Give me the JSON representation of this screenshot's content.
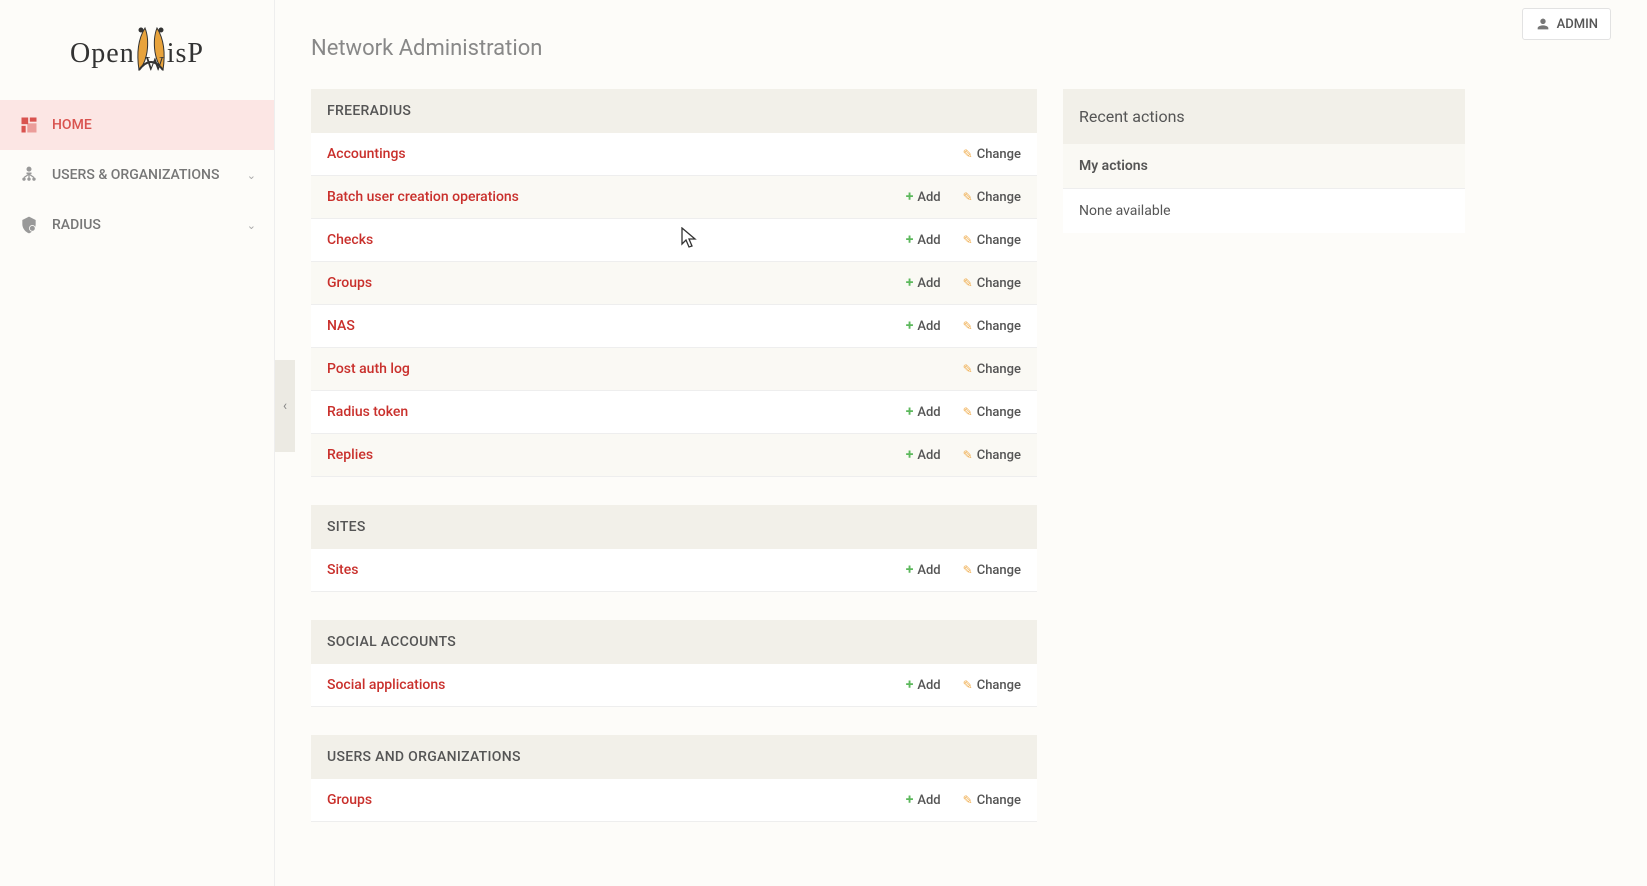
{
  "header": {
    "logo_text": "OpenWisp",
    "user_label": "ADMIN",
    "page_title": "Network Administration"
  },
  "sidebar": {
    "items": [
      {
        "label": "HOME",
        "icon": "dashboard-icon",
        "active": true,
        "expandable": false
      },
      {
        "label": "USERS & ORGANIZATIONS",
        "icon": "users-icon",
        "active": false,
        "expandable": true
      },
      {
        "label": "RADIUS",
        "icon": "shield-icon",
        "active": false,
        "expandable": true
      }
    ]
  },
  "modules": [
    {
      "title": "FREERADIUS",
      "rows": [
        {
          "name": "Accountings",
          "add": false,
          "change": true
        },
        {
          "name": "Batch user creation operations",
          "add": true,
          "change": true
        },
        {
          "name": "Checks",
          "add": true,
          "change": true
        },
        {
          "name": "Groups",
          "add": true,
          "change": true
        },
        {
          "name": "NAS",
          "add": true,
          "change": true
        },
        {
          "name": "Post auth log",
          "add": false,
          "change": true
        },
        {
          "name": "Radius token",
          "add": true,
          "change": true
        },
        {
          "name": "Replies",
          "add": true,
          "change": true
        }
      ]
    },
    {
      "title": "SITES",
      "rows": [
        {
          "name": "Sites",
          "add": true,
          "change": true
        }
      ]
    },
    {
      "title": "SOCIAL ACCOUNTS",
      "rows": [
        {
          "name": "Social applications",
          "add": true,
          "change": true
        }
      ]
    },
    {
      "title": "USERS AND ORGANIZATIONS",
      "rows": [
        {
          "name": "Groups",
          "add": true,
          "change": true
        }
      ]
    }
  ],
  "action_labels": {
    "add": "Add",
    "change": "Change"
  },
  "recent": {
    "title": "Recent actions",
    "my_actions": "My actions",
    "none": "None available"
  }
}
